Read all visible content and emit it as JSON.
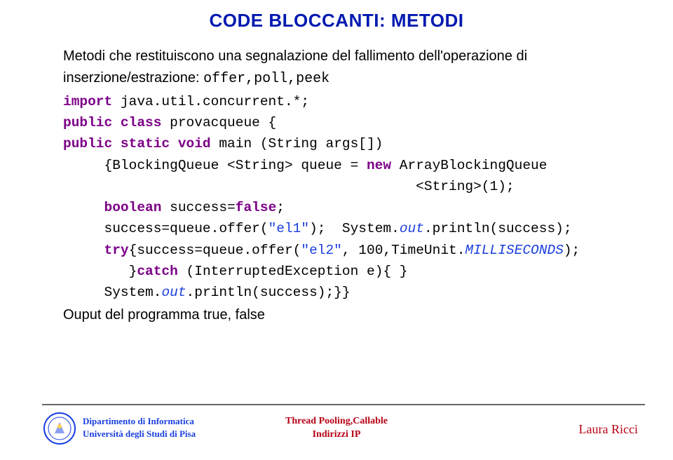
{
  "title": "CODE BLOCCANTI: METODI",
  "intro": {
    "line1": "Metodi che restituiscono una segnalazione del fallimento dell'operazione di",
    "line2a": "inserzione/estrazione: ",
    "methods": "offer,poll,peek"
  },
  "code": {
    "l1a": "import",
    "l1b": " java.util.concurrent.*;",
    "l2a": "public",
    "l2b": " class",
    "l2c": " provacqueue {",
    "l3a": "public static void",
    "l3b": " main (String args[])",
    "l4a": "     {BlockingQueue <String> queue = ",
    "l4b": "new",
    "l4c": " ArrayBlockingQueue",
    "l5": "                                           <String>(1);",
    "l6a": "     boolean",
    "l6b": " success=",
    "l6c": "false",
    "l6d": ";",
    "l7a": "     success=queue.offer(",
    "l7b": "\"el1\"",
    "l7c": ");  System.",
    "l7d": "out",
    "l7e": ".println(success);",
    "l8a": "     try",
    "l8b": "{success=queue.offer(",
    "l8c": "\"el2\"",
    "l8d": ", 100,TimeUnit.",
    "l8e": "MILLISECONDS",
    "l8f": ");",
    "l9a": "        }",
    "l9b": "catch",
    "l9c": " (InterruptedException e){ }",
    "l10a": "     System.",
    "l10b": "out",
    "l10c": ".println(success);}}"
  },
  "output_label": "Ouput del programma  true, false",
  "footer": {
    "affil1": "Dipartimento di Informatica",
    "affil2": "Università degli Studi di Pisa",
    "center1": "Thread Pooling,Callable",
    "center2": "Indirizzi IP",
    "author": "Laura Ricci"
  }
}
